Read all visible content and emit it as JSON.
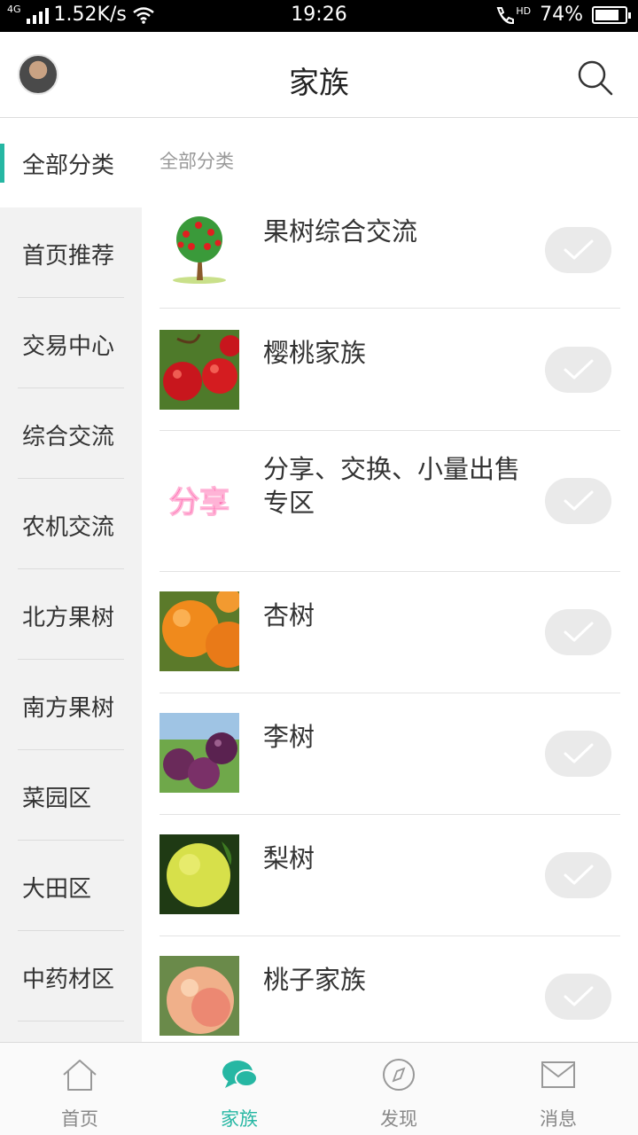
{
  "status_bar": {
    "network": "4G",
    "speed": "1.52K/s",
    "time": "19:26",
    "hd": "HD",
    "battery": "74%",
    "battery_level": 0.74
  },
  "header": {
    "title": "家族",
    "avatar_icon": "user-avatar",
    "search_icon": "search-icon"
  },
  "sidebar": {
    "items": [
      {
        "label": "全部分类",
        "active": true
      },
      {
        "label": "首页推荐"
      },
      {
        "label": "交易中心"
      },
      {
        "label": "综合交流"
      },
      {
        "label": "农机交流"
      },
      {
        "label": "北方果树"
      },
      {
        "label": "南方果树"
      },
      {
        "label": "菜园区"
      },
      {
        "label": "大田区"
      },
      {
        "label": "中药材区"
      }
    ]
  },
  "main": {
    "section_label": "全部分类",
    "rows": [
      {
        "title": "果树综合交流",
        "thumb": "fruit-tree"
      },
      {
        "title": "樱桃家族",
        "thumb": "cherry"
      },
      {
        "title": "分享、交换、小量出售专区",
        "thumb": "share-logo",
        "thumb_text": "分享"
      },
      {
        "title": "杏树",
        "thumb": "apricot"
      },
      {
        "title": "李树",
        "thumb": "plum"
      },
      {
        "title": "梨树",
        "thumb": "pear"
      },
      {
        "title": "桃子家族",
        "thumb": "peach"
      }
    ]
  },
  "bottom_nav": {
    "items": [
      {
        "label": "首页",
        "icon": "home-icon"
      },
      {
        "label": "家族",
        "icon": "chat-icon",
        "active": true
      },
      {
        "label": "发现",
        "icon": "compass-icon"
      },
      {
        "label": "消息",
        "icon": "mail-icon"
      }
    ]
  },
  "colors": {
    "accent": "#26b7a3",
    "sidebar_bg": "#f2f2f2",
    "check_bg": "#eaeaea"
  }
}
